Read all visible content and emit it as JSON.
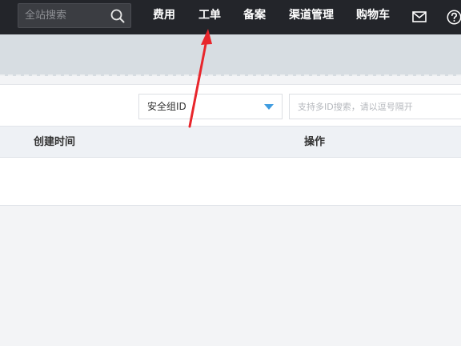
{
  "header": {
    "search": {
      "placeholder": "全站搜索",
      "value": "",
      "icon": "search-icon"
    },
    "nav": [
      {
        "label": "费用"
      },
      {
        "label": "工单"
      },
      {
        "label": "备案"
      },
      {
        "label": "渠道管理"
      },
      {
        "label": "购物车"
      }
    ],
    "icons": [
      "mail-icon",
      "help-icon"
    ]
  },
  "filter": {
    "select": {
      "value": "安全组ID",
      "icon": "caret-down-icon"
    },
    "input": {
      "placeholder": "支持多ID搜索，请以逗号隔开",
      "value": ""
    }
  },
  "table": {
    "columns": [
      "创建时间",
      "操作"
    ],
    "rows": []
  },
  "annotation": {
    "type": "arrow",
    "color": "#e8262c",
    "target": "工单"
  },
  "colors": {
    "topbar": "#23252a",
    "banner": "#d7dde2",
    "accent": "#3f9ce0",
    "page_bg": "#f3f4f6"
  }
}
